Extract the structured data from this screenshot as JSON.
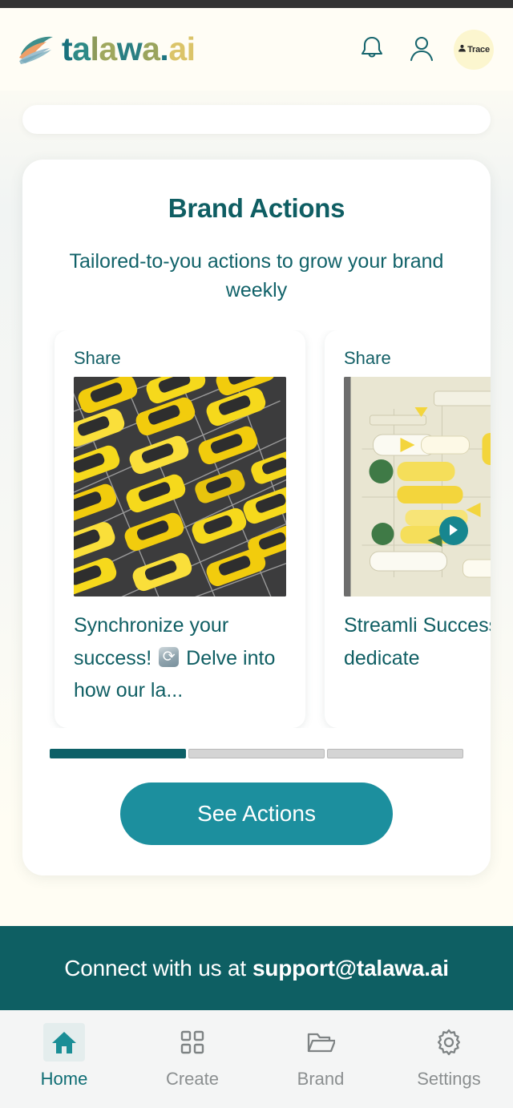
{
  "header": {
    "logo_text_parts": [
      "t",
      "a",
      "l",
      "a",
      "w",
      "a",
      ".",
      "ai"
    ],
    "logo_full": "talawa.ai",
    "notification_icon": "bell-icon",
    "profile_icon": "user-icon",
    "trace_badge_label": "Trace",
    "trace_badge_icon": "person-trace-icon",
    "trace_badge_color": "#fcf6cf"
  },
  "main": {
    "card_title": "Brand Actions",
    "card_subtitle": "Tailored-to-you actions to grow your brand weekly",
    "see_actions_label": "See Actions",
    "accent_color": "#1c8f9e",
    "title_color": "#0f5e63",
    "carousel": {
      "next_icon": "play-arrow-icon",
      "progress_total": 3,
      "progress_active_index": 0,
      "items": [
        {
          "badge": "Share",
          "caption_before": "Synchronize your success!",
          "caption_emoji": "sync-emoji",
          "caption_after": "Delve into how our la...",
          "image_alt": "aerial-view-yellow-taxis-parking-lot"
        },
        {
          "badge": "Share",
          "caption_before": "Streamli",
          "caption_emoji": "",
          "caption_after": "Success dedicate",
          "image_alt": "yellow-green-flowchart-diagram"
        }
      ]
    }
  },
  "support": {
    "prefix": "Connect with us at",
    "email": "support@talawa.ai",
    "background_color": "#0e5f63"
  },
  "bottom_nav": {
    "items": [
      {
        "label": "Home",
        "icon": "home-icon",
        "active": true
      },
      {
        "label": "Create",
        "icon": "grid-icon",
        "active": false
      },
      {
        "label": "Brand",
        "icon": "folder-icon",
        "active": false
      },
      {
        "label": "Settings",
        "icon": "gear-icon",
        "active": false
      }
    ]
  }
}
